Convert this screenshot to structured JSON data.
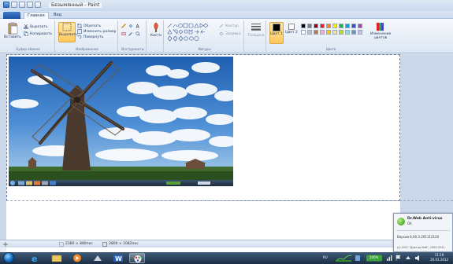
{
  "window": {
    "title": "Безымянный - Paint"
  },
  "tabs": [
    {
      "label": "Главная"
    },
    {
      "label": "Вид"
    }
  ],
  "ribbon": {
    "clipboard": {
      "paste_label": "Вставить",
      "cut_label": "Вырезать",
      "copy_label": "Копировать",
      "group_label": "Буфер обмена"
    },
    "image": {
      "select_label": "Выделить",
      "crop_label": "Обрезать",
      "resize_label": "Изменить размер",
      "rotate_label": "Повернуть",
      "group_label": "Изображение"
    },
    "tools": {
      "group_label": "Инструменты"
    },
    "brushes": {
      "label": "Кисти"
    },
    "shapes": {
      "outline_label": "Контур",
      "fill_label": "Заливка",
      "group_label": "Фигуры"
    },
    "size": {
      "label": "Толщина"
    },
    "colors": {
      "color1_label": "Цвет 1",
      "color2_label": "Цвет 2",
      "edit_label": "Изменение цветов",
      "group_label": "Цвета",
      "palette": [
        "#000000",
        "#7f7f7f",
        "#880015",
        "#ed1c24",
        "#ff7f27",
        "#fff200",
        "#22b14c",
        "#00a2e8",
        "#3f48cc",
        "#a349a4",
        "#ffffff",
        "#c3c3c3",
        "#b97a57",
        "#ffaec9",
        "#ffc90e",
        "#efe4b0",
        "#b5e61d",
        "#99d9ea",
        "#7092be",
        "#c8bfe7"
      ]
    }
  },
  "statusbar": {
    "selection_size": "2380 × 880пкс",
    "canvas_size": "2800 × 1082пкс",
    "zoom": "100%"
  },
  "notification": {
    "title": "Dr.Web Anti-virus",
    "status": "OK",
    "version": "Версия 6.00.3.201112120",
    "copyright": "(c) ООО \"Доктор Веб\", 1992-2011"
  },
  "taskbar": {
    "language": "RU",
    "time": "11:19",
    "date": "20.01.2012"
  }
}
